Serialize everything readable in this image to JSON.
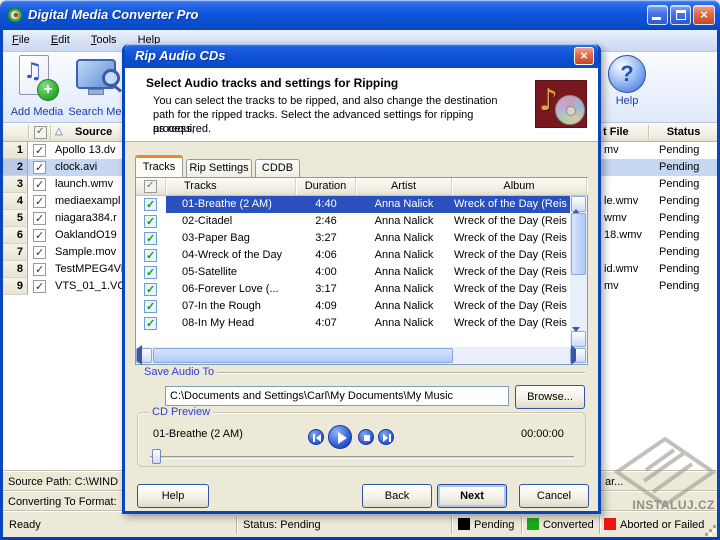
{
  "colors": {
    "titlebar_blue": "#0A4FD8",
    "selection_blue": "#2A50C0",
    "row_highlight": "#C6D7F2",
    "tab_accent_orange": "#E68B2C",
    "check_green": "#12A012"
  },
  "window": {
    "title": "Digital Media Converter Pro",
    "menu": [
      {
        "label": "File"
      },
      {
        "label": "Edit"
      },
      {
        "label": "Tools"
      },
      {
        "label": "Help"
      }
    ],
    "toolbar": [
      {
        "label": "Add Media"
      },
      {
        "label": "Search Med"
      },
      {
        "label": "Help"
      }
    ]
  },
  "main_table": {
    "header": {
      "source": "Source",
      "output_file": "t File",
      "status": "Status"
    },
    "rows": [
      {
        "num": "1",
        "source": "Apollo 13.dv",
        "output": "mv",
        "status": "Pending"
      },
      {
        "num": "2",
        "source": "clock.avi",
        "output": "",
        "status": "Pending"
      },
      {
        "num": "3",
        "source": "launch.wmv",
        "output": "",
        "status": "Pending"
      },
      {
        "num": "4",
        "source": "mediaexampl",
        "output": "le.wmv",
        "status": "Pending"
      },
      {
        "num": "5",
        "source": "niagara384.r",
        "output": "wmv",
        "status": "Pending"
      },
      {
        "num": "6",
        "source": "OaklandO19",
        "output": "18.wmv",
        "status": "Pending"
      },
      {
        "num": "7",
        "source": "Sample.mov",
        "output": "",
        "status": "Pending"
      },
      {
        "num": "8",
        "source": "TestMPEG4Vi",
        "output": "id.wmv",
        "status": "Pending"
      },
      {
        "num": "9",
        "source": "VTS_01_1.VO",
        "output": "mv",
        "status": "Pending"
      }
    ]
  },
  "dialog": {
    "title": "Rip Audio CDs",
    "header": {
      "title": "Select Audio tracks and settings for Ripping",
      "desc1": "You can select the tracks to be ripped, and also change the destination",
      "desc2": "path for the ripped tracks. Select the advanced settings for ripping process,",
      "desc3": "as required."
    },
    "tabs": [
      {
        "label": "Tracks"
      },
      {
        "label": "Rip Settings"
      },
      {
        "label": "CDDB"
      }
    ],
    "track_table": {
      "headers": {
        "tracks": "Tracks",
        "duration": "Duration",
        "artist": "Artist",
        "album": "Album"
      },
      "rows": [
        {
          "track": "01-Breathe (2 AM)",
          "duration": "4:40",
          "artist": "Anna Nalick",
          "album": "Wreck of the Day (Reis"
        },
        {
          "track": "02-Citadel",
          "duration": "2:46",
          "artist": "Anna Nalick",
          "album": "Wreck of the Day (Reis"
        },
        {
          "track": "03-Paper Bag",
          "duration": "3:27",
          "artist": "Anna Nalick",
          "album": "Wreck of the Day (Reis"
        },
        {
          "track": "04-Wreck of the Day",
          "duration": "4:06",
          "artist": "Anna Nalick",
          "album": "Wreck of the Day (Reis"
        },
        {
          "track": "05-Satellite",
          "duration": "4:00",
          "artist": "Anna Nalick",
          "album": "Wreck of the Day (Reis"
        },
        {
          "track": "06-Forever Love (...",
          "duration": "3:17",
          "artist": "Anna Nalick",
          "album": "Wreck of the Day (Reis"
        },
        {
          "track": "07-In the Rough",
          "duration": "4:09",
          "artist": "Anna Nalick",
          "album": "Wreck of the Day (Reis"
        },
        {
          "track": "08-In My Head",
          "duration": "4:07",
          "artist": "Anna Nalick",
          "album": "Wreck of the Day (Reis"
        }
      ]
    },
    "save_group": {
      "label": "Save Audio To",
      "path": "C:\\Documents and Settings\\Carl\\My Documents\\My Music",
      "browse_label": "Browse..."
    },
    "preview_group": {
      "label": "CD Preview",
      "track": "01-Breathe (2 AM)",
      "time": "00:00:00"
    },
    "footer": {
      "help": "Help",
      "back": "Back",
      "next": "Next",
      "cancel": "Cancel"
    }
  },
  "bottom": {
    "source_path": "Source Path:  C:\\WIND",
    "clear_fragment": "ar...",
    "converting": "Converting To Format:",
    "ready": "Ready",
    "status": "Status:  Pending",
    "legend": [
      {
        "label": "Pending",
        "color": "#000000"
      },
      {
        "label": "Converted",
        "color": "#1CA81C"
      },
      {
        "label": "Aborted or Failed",
        "color": "#EE1414"
      }
    ]
  },
  "watermark": {
    "text": "INSTALUJ.CZ"
  }
}
